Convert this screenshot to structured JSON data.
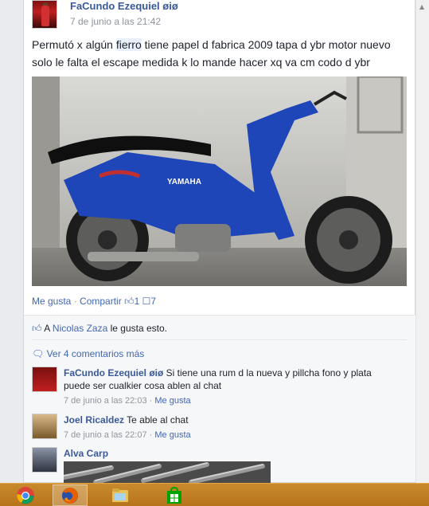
{
  "post": {
    "author": "FaCundo Ezequiel øiø",
    "timestamp": "7 de junio a las 21:42",
    "text_before": "Permutó x algún ",
    "text_highlight": "fierro",
    "text_after": " tiene papel d fabrica 2009 tapa d ybr motor nuevo solo le falta el escape medida k lo mande hacer xq va cm codo d ybr"
  },
  "actions": {
    "like": "Me gusta",
    "share": "Compartir",
    "likes_count": "1",
    "comments_count": "7",
    "sep": " · "
  },
  "likes": {
    "prefix": "A ",
    "liker": "Nicolas Zaza",
    "suffix": " le gusta esto."
  },
  "view_more": "Ver 4 comentarios más",
  "comments": [
    {
      "author": "FaCundo Ezequiel øiø",
      "text": " Si tiene una rum d la nueva y pillcha fono y plata puede ser cualkier cosa ablen al chat",
      "time": "7 de junio a las 22:03",
      "like": "Me gusta"
    },
    {
      "author": "Joel Ricaldez",
      "text": " Te able al chat",
      "time": "7 de junio a las 22:07",
      "like": "Me gusta"
    },
    {
      "author": "Alva Carp",
      "text": ""
    }
  ],
  "icons": {
    "like": "thumbs-up-icon",
    "comment": "comment-bubble-icon",
    "chrome": "chrome-icon",
    "firefox": "firefox-icon",
    "explorer": "file-explorer-icon",
    "store": "windows-store-icon"
  },
  "colors": {
    "link": "#4267b2",
    "name": "#3b5998",
    "meta": "#90949c",
    "taskbar": "#c0802a"
  }
}
